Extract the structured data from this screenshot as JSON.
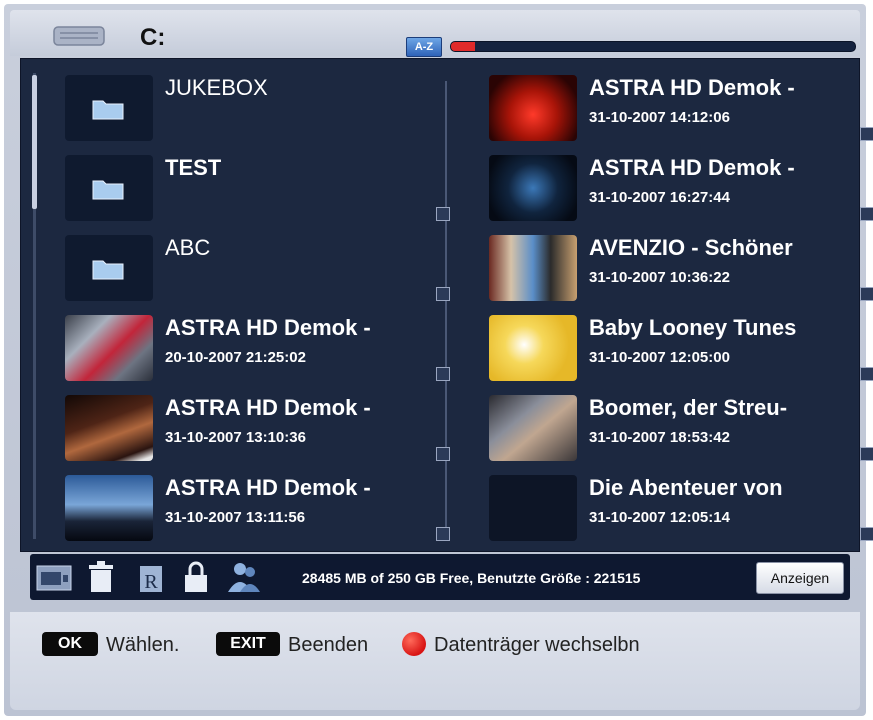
{
  "header": {
    "drive": "C:",
    "sort_label": "A-Z",
    "progress_fraction": 0.06
  },
  "left_items": [
    {
      "kind": "folder",
      "title": "JUKEBOX",
      "date": "",
      "checkbox": false
    },
    {
      "kind": "folder",
      "title": "TEST",
      "date": "",
      "checkbox": true
    },
    {
      "kind": "folder",
      "title": "ABC",
      "date": "",
      "checkbox": true
    },
    {
      "kind": "video",
      "title": "ASTRA HD Demok -",
      "date": "20-10-2007 21:25:02",
      "checkbox": true
    },
    {
      "kind": "video",
      "title": "ASTRA HD Demok -",
      "date": "31-10-2007 13:10:36",
      "checkbox": true
    },
    {
      "kind": "video",
      "title": "ASTRA HD Demok -",
      "date": "31-10-2007 13:11:56",
      "checkbox": true
    }
  ],
  "right_items": [
    {
      "kind": "video",
      "title": "ASTRA HD Demok -",
      "date": "31-10-2007 14:12:06",
      "checkbox": true
    },
    {
      "kind": "video",
      "title": "ASTRA HD Demok -",
      "date": "31-10-2007 16:27:44",
      "checkbox": true
    },
    {
      "kind": "video",
      "title": "AVENZIO - Schöner",
      "date": "31-10-2007 10:36:22",
      "checkbox": true
    },
    {
      "kind": "video",
      "title": "Baby Looney Tunes",
      "date": "31-10-2007 12:05:00",
      "checkbox": true
    },
    {
      "kind": "video",
      "title": "Boomer, der Streu-",
      "date": "31-10-2007 18:53:42",
      "checkbox": true
    },
    {
      "kind": "video",
      "title": "Die Abenteuer von",
      "date": "31-10-2007 12:05:14",
      "checkbox": true
    }
  ],
  "toolbar": {
    "status": "28485 MB of 250 GB Free, Benutzte Größe : 221515",
    "button_label": "Anzeigen",
    "icons": [
      "video-mode-icon",
      "delete-icon",
      "rename-icon",
      "lock-icon",
      "users-icon"
    ]
  },
  "footer": {
    "ok_key": "OK",
    "ok_label": "Wählen.",
    "exit_key": "EXIT",
    "exit_label": "Beenden",
    "red_label": "Datenträger wechselbn"
  },
  "colors": {
    "panel": "#1c2840",
    "accent_red": "#e02a2a",
    "accent_blue": "#2f63b8"
  }
}
